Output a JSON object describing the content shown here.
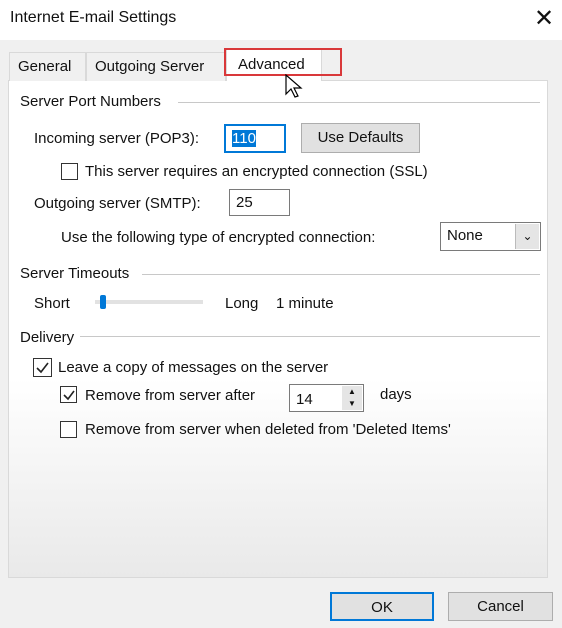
{
  "window": {
    "title": "Internet E-mail Settings",
    "close_icon": "close-icon"
  },
  "tabs": [
    {
      "label": "General"
    },
    {
      "label": "Outgoing Server"
    },
    {
      "label": "Advanced",
      "active": true
    }
  ],
  "server_ports": {
    "heading": "Server Port Numbers",
    "incoming_label": "Incoming server (POP3):",
    "incoming_value": "110",
    "use_defaults": "Use Defaults",
    "ssl_label": "This server requires an encrypted connection (SSL)",
    "ssl_checked": false,
    "outgoing_label": "Outgoing server (SMTP):",
    "outgoing_value": "25",
    "encryption_label": "Use the following type of encrypted connection:",
    "encryption_value": "None"
  },
  "timeouts": {
    "heading": "Server Timeouts",
    "short": "Short",
    "long": "Long",
    "value": "1 minute",
    "slider_fraction": 0.05
  },
  "delivery": {
    "heading": "Delivery",
    "leave_copy": "Leave a copy of messages on the server",
    "leave_copy_checked": true,
    "remove_after": "Remove from server after",
    "remove_after_checked": true,
    "days_value": "14",
    "days": "days",
    "remove_deleted": "Remove from server when deleted from 'Deleted Items'",
    "remove_deleted_checked": false
  },
  "footer": {
    "ok": "OK",
    "cancel": "Cancel"
  },
  "colors": {
    "highlight": "#d9383a",
    "selection": "#0078d7"
  }
}
